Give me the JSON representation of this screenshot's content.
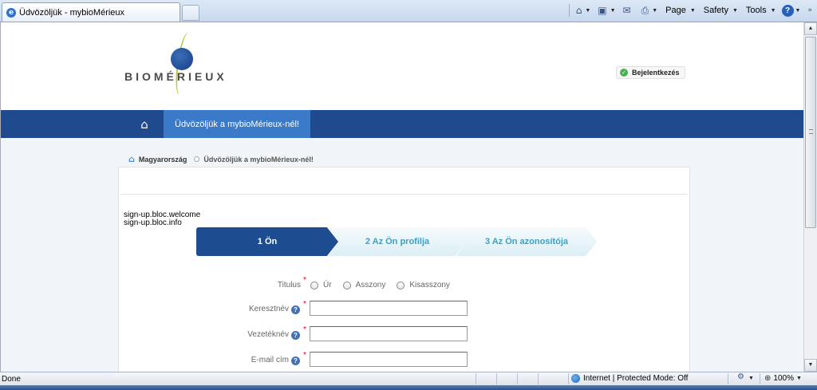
{
  "browser": {
    "tab_title": "Üdvözöljük - mybioMérieux",
    "menus": [
      "Page",
      "Safety",
      "Tools"
    ],
    "status_text": "Done",
    "zone_text": "Internet | Protected Mode: Off",
    "zoom_text": "100%"
  },
  "header": {
    "logo_text": "BIOMÉRIEUX",
    "login_label": "Bejelentkezés"
  },
  "nav": {
    "active_item": "Üdvözöljük a mybioMérieux-nél!"
  },
  "breadcrumb": {
    "home": "Magyarország",
    "current": "Üdvözöljük a mybioMérieux-nél!"
  },
  "signup": {
    "welcome_key": "sign-up.bloc.welcome",
    "info_key": "sign-up.bloc.info",
    "steps": [
      "1 Ön",
      "2 Az Ön profilja",
      "3 Az Ön azonosítója"
    ]
  },
  "form": {
    "title_label": "Titulus",
    "title_options": [
      "Úr",
      "Asszony",
      "Kisasszony"
    ],
    "first_name_label": "Keresztnév",
    "last_name_label": "Vezetéknév",
    "email_label": "E-mail cím",
    "required_mark": "*"
  }
}
